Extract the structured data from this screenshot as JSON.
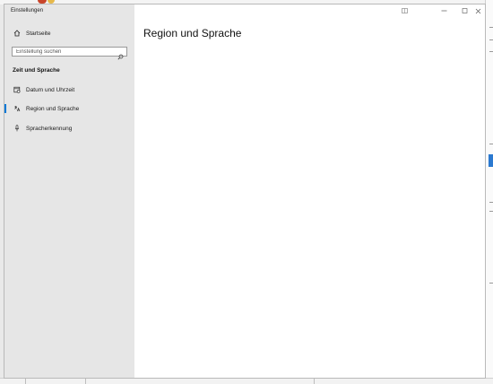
{
  "window": {
    "title": "Einstellungen"
  },
  "sidebar": {
    "home_label": "Startseite",
    "search_placeholder": "Einstellung suchen",
    "section_heading": "Zeit und Sprache",
    "items": [
      {
        "label": "Datum und Uhrzeit",
        "icon": "calendar-clock-icon",
        "active": false
      },
      {
        "label": "Region und Sprache",
        "icon": "language-icon",
        "active": true
      },
      {
        "label": "Spracherkennung",
        "icon": "microphone-icon",
        "active": false
      }
    ]
  },
  "main": {
    "page_title": "Region und Sprache"
  },
  "title_bar": {
    "buttons": [
      "snap-layout-icon",
      "minimize-icon",
      "maximize-icon",
      "close-icon"
    ]
  },
  "colors": {
    "accent": "#0078d7",
    "sidebar_bg": "#e6e6e6",
    "content_bg": "#ffffff"
  }
}
